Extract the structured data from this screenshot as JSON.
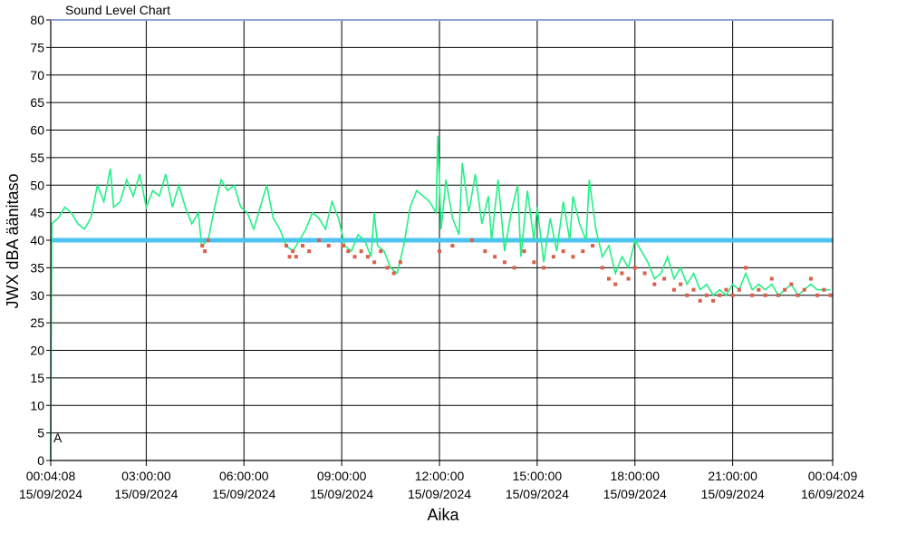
{
  "chart_data": {
    "type": "line",
    "title": "Sound Level Chart",
    "xlabel": "Aika",
    "ylabel": "JWX dBA äänitaso",
    "ylim": [
      0,
      80
    ],
    "yticks": [
      0,
      5,
      10,
      15,
      20,
      25,
      30,
      35,
      40,
      45,
      50,
      55,
      60,
      65,
      70,
      75,
      80
    ],
    "xlim_hours": [
      0.0689,
      24.0692
    ],
    "xticks": [
      {
        "h": 0.0689,
        "time": "00:04:08",
        "date": "15/09/2024"
      },
      {
        "h": 3,
        "time": "03:00:00",
        "date": "15/09/2024"
      },
      {
        "h": 6,
        "time": "06:00:00",
        "date": "15/09/2024"
      },
      {
        "h": 9,
        "time": "09:00:00",
        "date": "15/09/2024"
      },
      {
        "h": 12,
        "time": "12:00:00",
        "date": "15/09/2024"
      },
      {
        "h": 15,
        "time": "15:00:00",
        "date": "15/09/2024"
      },
      {
        "h": 18,
        "time": "18:00:00",
        "date": "15/09/2024"
      },
      {
        "h": 21,
        "time": "21:00:00",
        "date": "15/09/2024"
      },
      {
        "h": 24.0692,
        "time": "00:04:09",
        "date": "16/09/2024"
      }
    ],
    "grid": true,
    "threshold": {
      "value": 40,
      "color": "#4cc3f0"
    },
    "marker_text": "A",
    "series": [
      {
        "color": "#22f086",
        "points": [
          [
            0.07,
            0
          ],
          [
            0.1,
            43
          ],
          [
            0.3,
            44
          ],
          [
            0.5,
            46
          ],
          [
            0.7,
            45
          ],
          [
            0.9,
            43
          ],
          [
            1.1,
            42
          ],
          [
            1.3,
            44
          ],
          [
            1.5,
            50
          ],
          [
            1.7,
            47
          ],
          [
            1.9,
            53
          ],
          [
            2.0,
            46
          ],
          [
            2.2,
            47
          ],
          [
            2.4,
            51
          ],
          [
            2.6,
            48
          ],
          [
            2.8,
            52
          ],
          [
            3.0,
            46
          ],
          [
            3.2,
            49
          ],
          [
            3.4,
            48
          ],
          [
            3.6,
            52
          ],
          [
            3.8,
            46
          ],
          [
            4.0,
            50
          ],
          [
            4.2,
            46
          ],
          [
            4.4,
            43
          ],
          [
            4.6,
            45
          ],
          [
            4.7,
            39
          ],
          [
            4.9,
            40
          ],
          [
            5.1,
            46
          ],
          [
            5.3,
            51
          ],
          [
            5.5,
            49
          ],
          [
            5.7,
            50
          ],
          [
            5.9,
            46
          ],
          [
            6.1,
            45
          ],
          [
            6.3,
            42
          ],
          [
            6.5,
            46
          ],
          [
            6.7,
            50
          ],
          [
            6.9,
            44
          ],
          [
            7.1,
            42
          ],
          [
            7.3,
            39
          ],
          [
            7.5,
            38
          ],
          [
            7.7,
            40
          ],
          [
            7.9,
            42
          ],
          [
            8.1,
            45
          ],
          [
            8.3,
            44
          ],
          [
            8.5,
            42
          ],
          [
            8.7,
            47
          ],
          [
            8.9,
            44
          ],
          [
            9.1,
            39
          ],
          [
            9.3,
            38
          ],
          [
            9.5,
            41
          ],
          [
            9.7,
            40
          ],
          [
            9.9,
            37
          ],
          [
            10.0,
            45
          ],
          [
            10.1,
            39
          ],
          [
            10.3,
            38
          ],
          [
            10.5,
            35
          ],
          [
            10.7,
            34
          ],
          [
            10.9,
            39
          ],
          [
            11.1,
            46
          ],
          [
            11.3,
            49
          ],
          [
            11.5,
            48
          ],
          [
            11.7,
            47
          ],
          [
            11.9,
            45
          ],
          [
            11.95,
            59
          ],
          [
            12.05,
            42
          ],
          [
            12.2,
            51
          ],
          [
            12.4,
            44
          ],
          [
            12.6,
            41
          ],
          [
            12.7,
            54
          ],
          [
            12.9,
            45
          ],
          [
            13.1,
            52
          ],
          [
            13.3,
            43
          ],
          [
            13.5,
            48
          ],
          [
            13.6,
            40
          ],
          [
            13.8,
            51
          ],
          [
            14.0,
            38
          ],
          [
            14.2,
            45
          ],
          [
            14.4,
            50
          ],
          [
            14.5,
            37
          ],
          [
            14.7,
            49
          ],
          [
            14.9,
            40
          ],
          [
            15.0,
            46
          ],
          [
            15.2,
            36
          ],
          [
            15.4,
            44
          ],
          [
            15.6,
            38
          ],
          [
            15.8,
            47
          ],
          [
            16.0,
            40
          ],
          [
            16.1,
            48
          ],
          [
            16.3,
            43
          ],
          [
            16.5,
            40
          ],
          [
            16.6,
            51
          ],
          [
            16.8,
            42
          ],
          [
            17.0,
            37
          ],
          [
            17.2,
            39
          ],
          [
            17.4,
            34
          ],
          [
            17.6,
            37
          ],
          [
            17.8,
            35
          ],
          [
            18.0,
            40
          ],
          [
            18.2,
            38
          ],
          [
            18.4,
            36
          ],
          [
            18.6,
            33
          ],
          [
            18.8,
            34
          ],
          [
            19.0,
            37
          ],
          [
            19.2,
            33
          ],
          [
            19.4,
            35
          ],
          [
            19.6,
            32
          ],
          [
            19.8,
            34
          ],
          [
            20.0,
            31
          ],
          [
            20.2,
            32
          ],
          [
            20.4,
            30
          ],
          [
            20.6,
            31
          ],
          [
            20.8,
            30
          ],
          [
            21.0,
            32
          ],
          [
            21.2,
            31
          ],
          [
            21.4,
            34
          ],
          [
            21.6,
            31
          ],
          [
            21.8,
            32
          ],
          [
            22.0,
            31
          ],
          [
            22.2,
            32
          ],
          [
            22.4,
            30
          ],
          [
            22.6,
            31
          ],
          [
            22.8,
            32
          ],
          [
            23.0,
            30
          ],
          [
            23.2,
            31
          ],
          [
            23.4,
            32
          ],
          [
            23.6,
            31
          ],
          [
            23.8,
            31
          ],
          [
            24.0,
            31
          ]
        ]
      }
    ],
    "markers": {
      "color": "#d9604a",
      "points": [
        [
          4.72,
          39
        ],
        [
          4.8,
          38
        ],
        [
          4.9,
          40
        ],
        [
          7.3,
          39
        ],
        [
          7.4,
          37
        ],
        [
          7.5,
          38
        ],
        [
          7.6,
          37
        ],
        [
          7.8,
          39
        ],
        [
          8.0,
          38
        ],
        [
          8.3,
          40
        ],
        [
          8.6,
          39
        ],
        [
          9.05,
          39
        ],
        [
          9.2,
          38
        ],
        [
          9.4,
          37
        ],
        [
          9.6,
          38
        ],
        [
          9.8,
          37
        ],
        [
          10.0,
          36
        ],
        [
          10.2,
          38
        ],
        [
          10.4,
          35
        ],
        [
          10.6,
          34
        ],
        [
          10.8,
          36
        ],
        [
          12.0,
          38
        ],
        [
          12.4,
          39
        ],
        [
          13.0,
          40
        ],
        [
          13.4,
          38
        ],
        [
          13.7,
          37
        ],
        [
          14.0,
          36
        ],
        [
          14.3,
          35
        ],
        [
          14.6,
          38
        ],
        [
          14.9,
          36
        ],
        [
          15.2,
          35
        ],
        [
          15.5,
          37
        ],
        [
          15.8,
          38
        ],
        [
          16.1,
          37
        ],
        [
          16.4,
          38
        ],
        [
          16.7,
          39
        ],
        [
          17.0,
          35
        ],
        [
          17.2,
          33
        ],
        [
          17.4,
          32
        ],
        [
          17.6,
          34
        ],
        [
          17.8,
          33
        ],
        [
          18.0,
          35
        ],
        [
          18.3,
          34
        ],
        [
          18.6,
          32
        ],
        [
          18.9,
          33
        ],
        [
          19.2,
          31
        ],
        [
          19.4,
          32
        ],
        [
          19.6,
          30
        ],
        [
          19.8,
          31
        ],
        [
          20.0,
          29
        ],
        [
          20.2,
          30
        ],
        [
          20.4,
          29
        ],
        [
          20.6,
          30
        ],
        [
          20.8,
          31
        ],
        [
          21.0,
          30
        ],
        [
          21.2,
          31
        ],
        [
          21.4,
          35
        ],
        [
          21.6,
          30
        ],
        [
          21.8,
          31
        ],
        [
          22.0,
          30
        ],
        [
          22.2,
          33
        ],
        [
          22.4,
          30
        ],
        [
          22.6,
          31
        ],
        [
          22.8,
          32
        ],
        [
          23.0,
          30
        ],
        [
          23.2,
          31
        ],
        [
          23.4,
          33
        ],
        [
          23.6,
          30
        ],
        [
          23.8,
          31
        ],
        [
          24.0,
          30
        ]
      ]
    }
  }
}
